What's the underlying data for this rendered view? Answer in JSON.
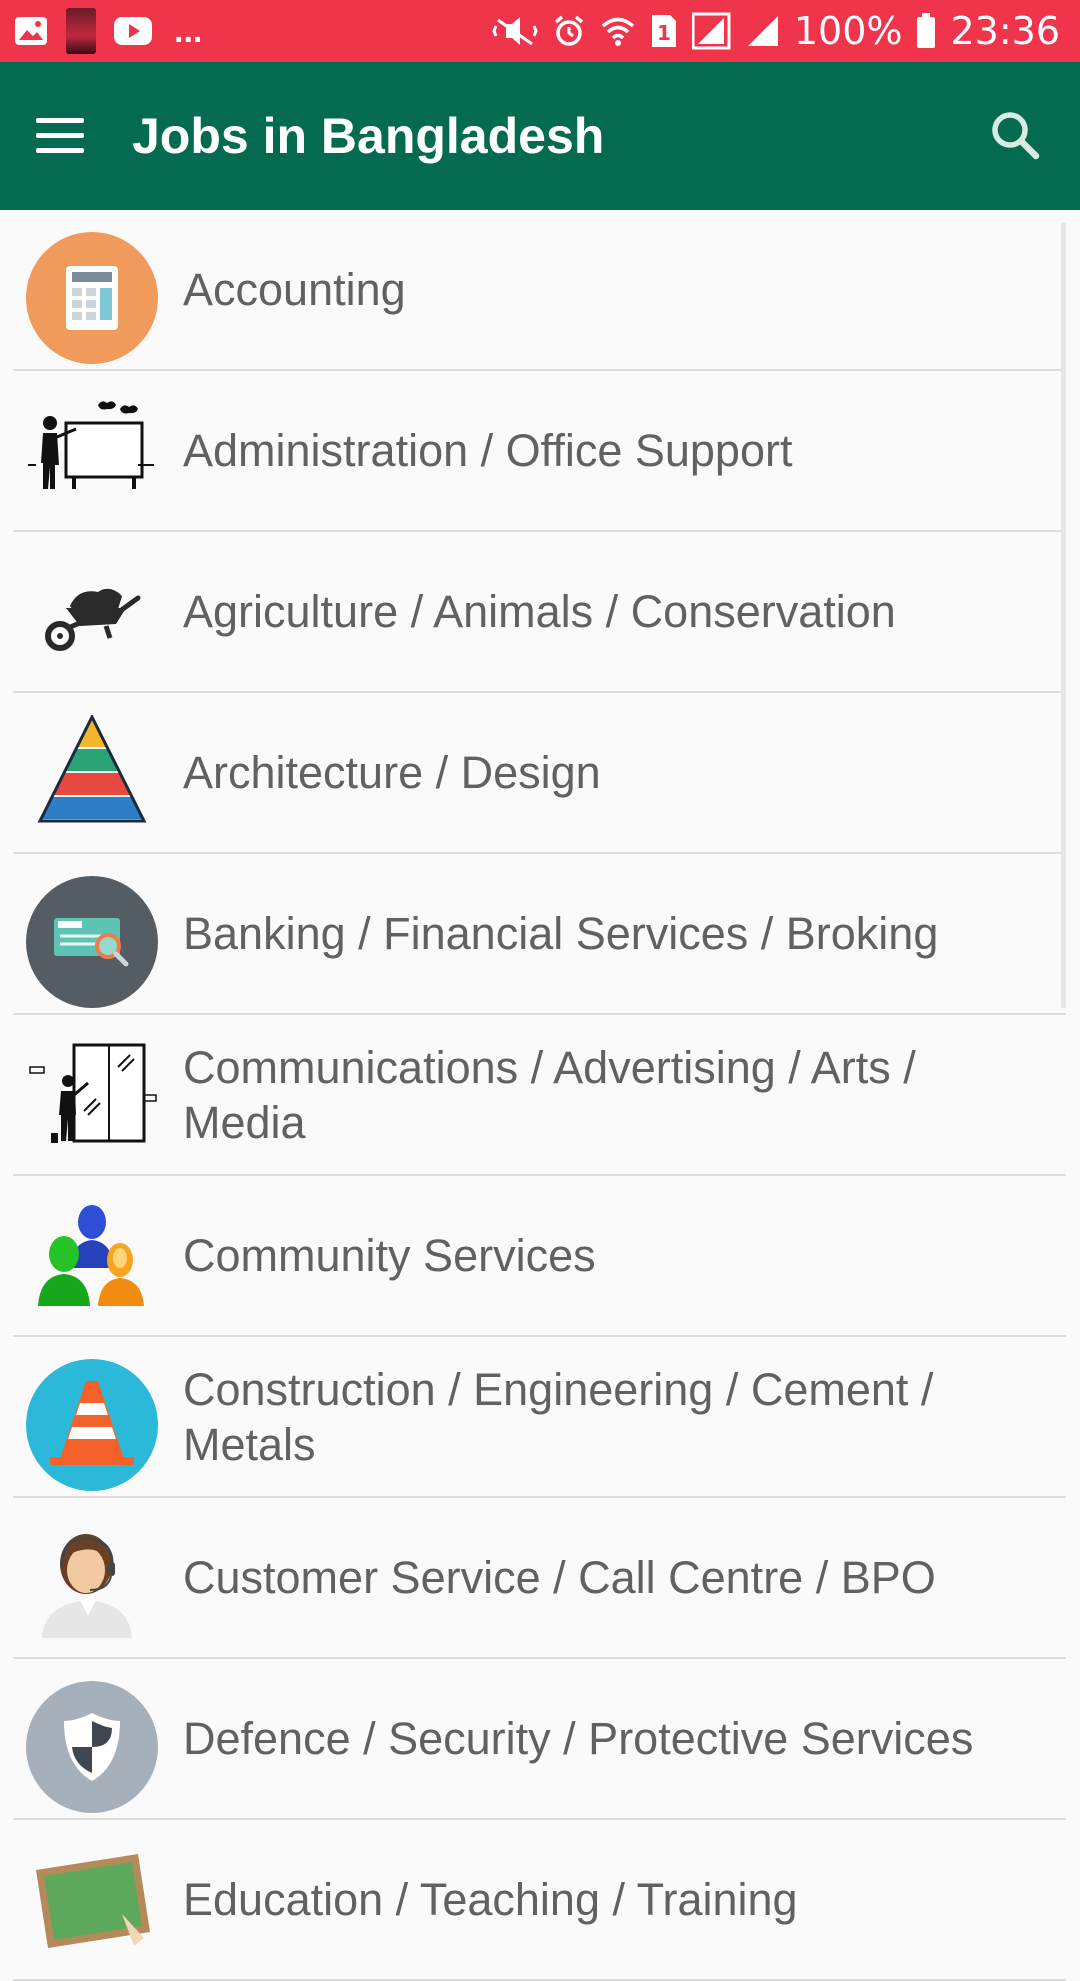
{
  "status_bar": {
    "ellipsis": "...",
    "battery": "100%",
    "time": "23:36"
  },
  "app_bar": {
    "title": "Jobs in Bangladesh"
  },
  "categories": [
    {
      "label": "Accounting",
      "icon": "calculator-icon"
    },
    {
      "label": "Administration / Office Support",
      "icon": "presenter-board-icon"
    },
    {
      "label": "Agriculture / Animals / Conservation",
      "icon": "wheelbarrow-icon"
    },
    {
      "label": "Architecture / Design",
      "icon": "pyramid-icon"
    },
    {
      "label": "Banking / Financial Services / Broking",
      "icon": "cheque-icon"
    },
    {
      "label": "Communications / Advertising / Arts / Media",
      "icon": "whiteboard-person-icon"
    },
    {
      "label": "Community Services",
      "icon": "people-group-icon"
    },
    {
      "label": "Construction / Engineering / Cement / Metals",
      "icon": "traffic-cone-icon"
    },
    {
      "label": "Customer Service / Call Centre / BPO",
      "icon": "call-agent-icon"
    },
    {
      "label": "Defence / Security / Protective Services",
      "icon": "shield-icon"
    },
    {
      "label": "Education / Teaching / Training",
      "icon": "chalkboard-icon"
    }
  ],
  "colors": {
    "status_bar": "#f0344b",
    "app_bar": "#046b50",
    "text": "#616161"
  }
}
